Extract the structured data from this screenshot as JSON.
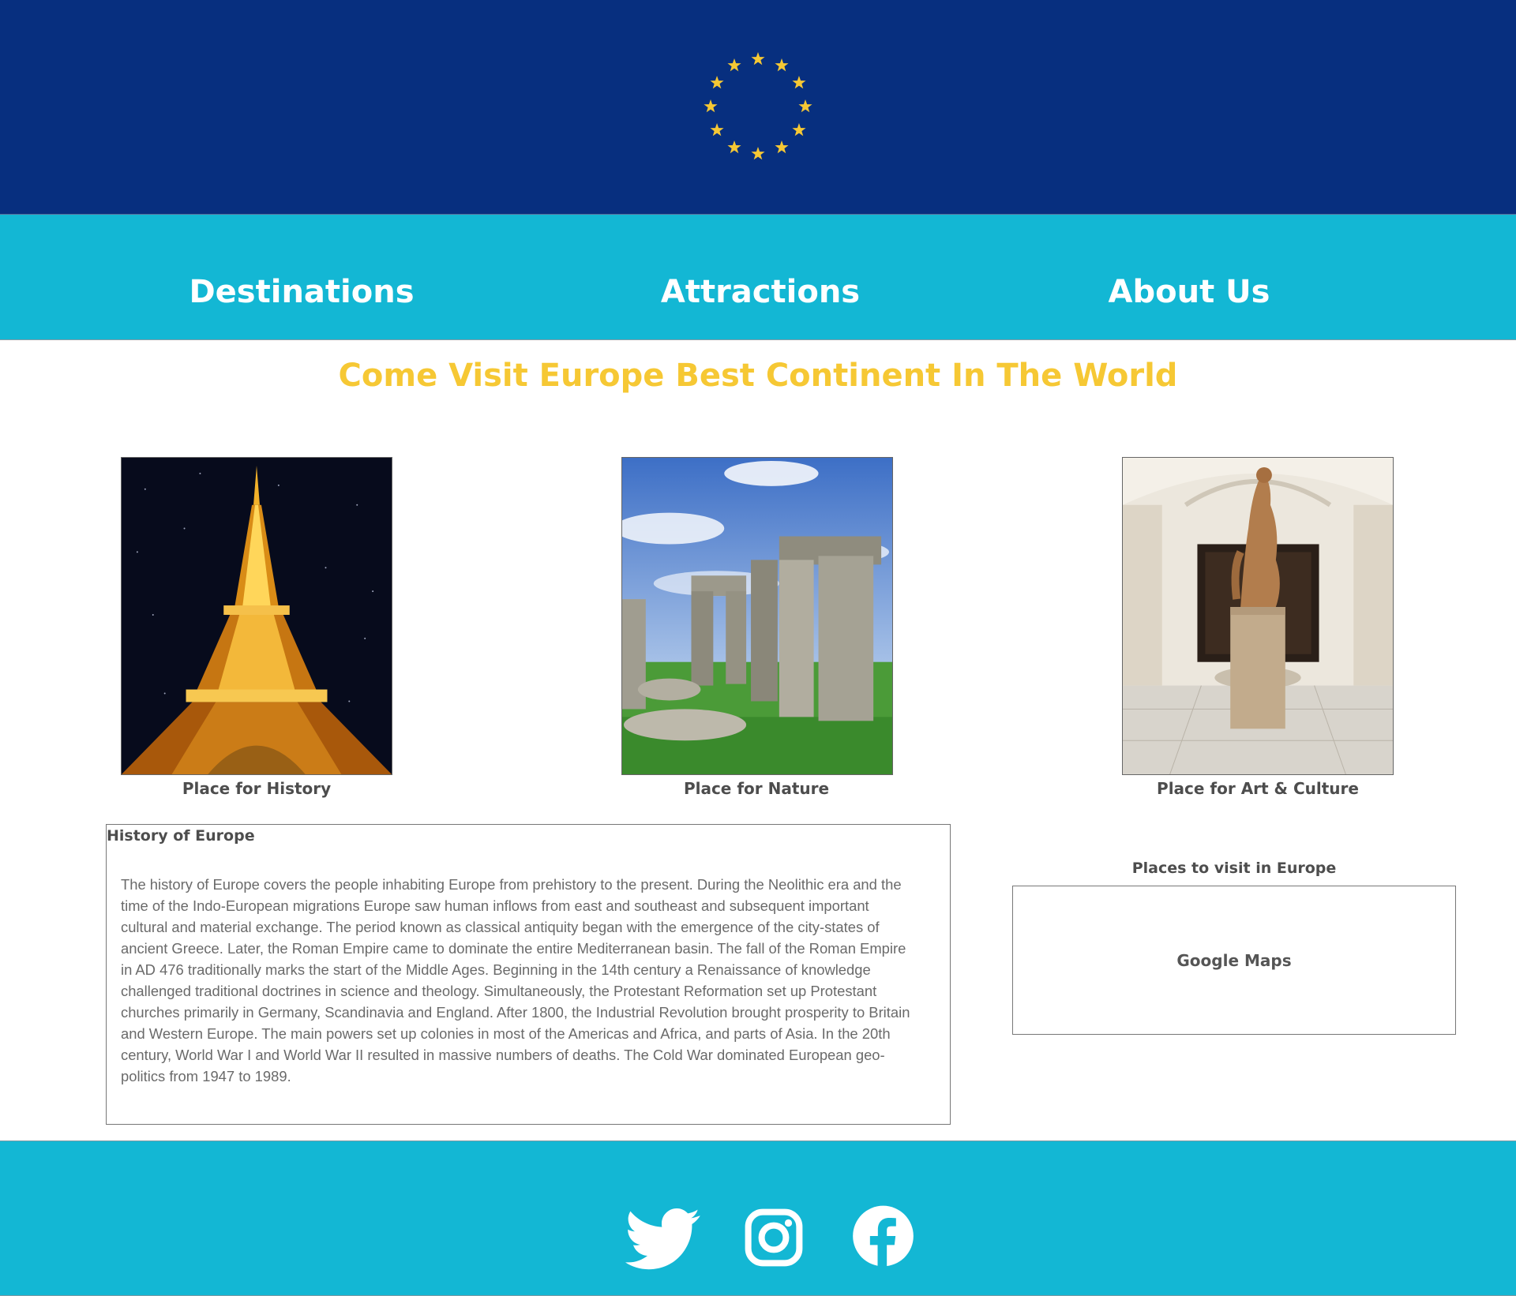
{
  "header": {
    "logo_icon": "eu-flag-stars-icon",
    "star_color": "#f6c834",
    "background": "#072f7f"
  },
  "nav": {
    "items": [
      "Destinations",
      "Attractions",
      "About Us"
    ],
    "background": "#13b7d4"
  },
  "main": {
    "headline": "Come Visit Europe Best Continent In The World",
    "cards": [
      {
        "caption": "Place for History",
        "image": "eiffel-tower-night"
      },
      {
        "caption": "Place for Nature",
        "image": "stonehenge"
      },
      {
        "caption": "Place for Art & Culture",
        "image": "museum-sculpture-hall"
      }
    ],
    "history": {
      "title": "History of Europe",
      "body": "The history of Europe covers the people inhabiting Europe from prehistory to the present. During the Neolithic era and the time of the Indo-European migrations Europe saw human inflows from east and southeast and subsequent important cultural and material exchange. The period known as classical antiquity began with the emergence of the city-states of ancient Greece. Later, the Roman Empire came to dominate the entire Mediterranean basin. The fall of the Roman Empire in AD 476 traditionally marks the start of the Middle Ages. Beginning in the 14th century a Renaissance of knowledge challenged traditional doctrines in science and theology. Simultaneously, the Protestant Reformation set up Protestant churches primarily in Germany, Scandinavia and England. After 1800, the Industrial Revolution brought prosperity to Britain and Western Europe. The main powers set up colonies in most of the Americas and Africa, and parts of Asia. In the 20th century, World War I and World War II resulted in massive numbers of deaths. The Cold War dominated European geo-politics from 1947 to 1989."
    },
    "places": {
      "title": "Places to visit in Europe",
      "map_label": "Google Maps"
    }
  },
  "footer": {
    "social_icons": [
      "twitter-icon",
      "instagram-icon",
      "facebook-icon"
    ]
  },
  "colors": {
    "headline": "#f6c834",
    "accent": "#13b7d4",
    "header": "#072f7f"
  }
}
